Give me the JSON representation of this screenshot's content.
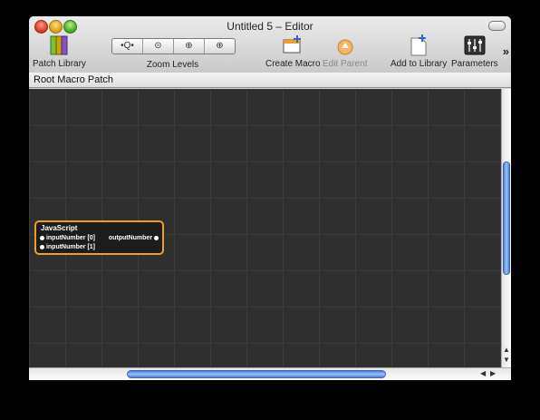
{
  "window": {
    "title": "Untitled 5 – Editor"
  },
  "toolbar": {
    "patch_library": {
      "label": "Patch Library",
      "icon": "books-icon"
    },
    "zoom_levels": {
      "label": "Zoom Levels",
      "buttons": [
        "•Q•",
        "⊝",
        "⊕",
        "⊕"
      ]
    },
    "create_macro": {
      "label": "Create Macro",
      "icon": "create-macro-icon"
    },
    "edit_parent": {
      "label": "Edit Parent",
      "icon": "edit-parent-icon",
      "enabled": false
    },
    "add_to_library": {
      "label": "Add to Library",
      "icon": "add-document-icon"
    },
    "parameters": {
      "label": "Parameters",
      "icon": "sliders-icon"
    },
    "overflow": "»"
  },
  "breadcrumb": "Root Macro Patch",
  "patch": {
    "title": "JavaScript",
    "inputs": [
      "inputNumber [0]",
      "inputNumber [1]"
    ],
    "outputs": [
      "outputNumber"
    ],
    "accent": "#f0a020"
  }
}
